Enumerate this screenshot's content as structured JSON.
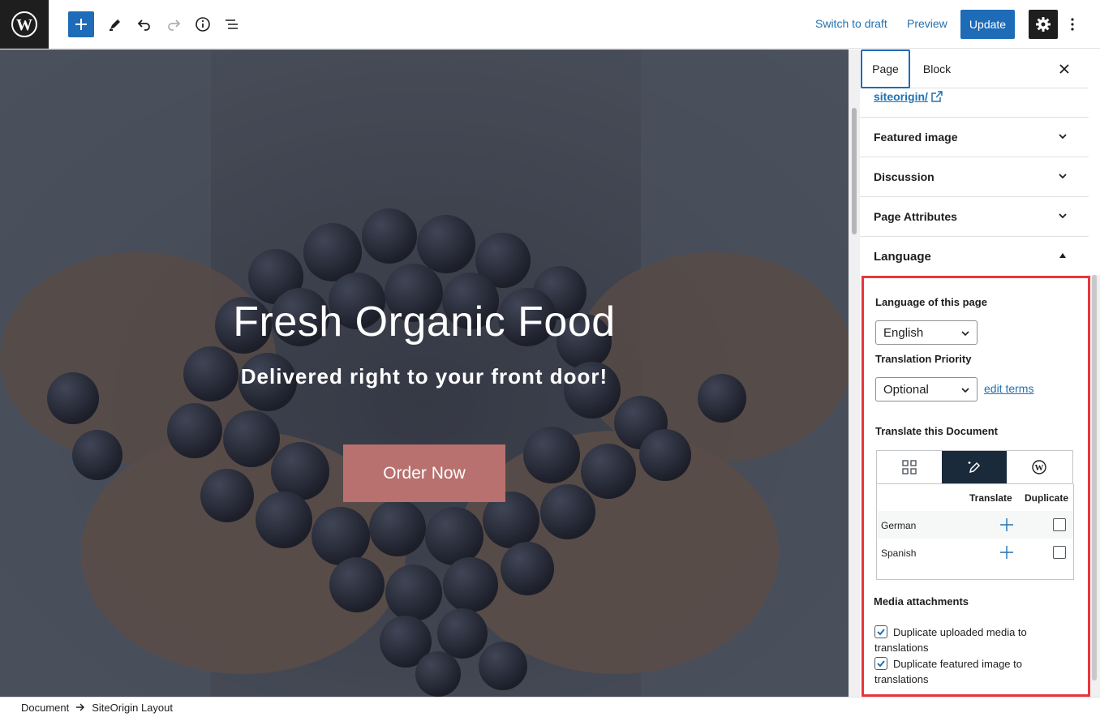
{
  "toolbar": {
    "logo_icon": "wordpress-logo-icon",
    "add_icon": "plus-icon",
    "edit_icon": "pencil-icon",
    "undo_icon": "undo-icon",
    "redo_icon": "redo-icon",
    "info_icon": "info-icon",
    "list_view_icon": "list-view-icon",
    "switch_to_draft": "Switch to draft",
    "preview": "Preview",
    "update": "Update",
    "settings_icon": "gear-icon",
    "options_icon": "vertical-ellipsis-icon"
  },
  "hero": {
    "title": "Fresh Organic Food",
    "subtitle": "Delivered right to your front door!",
    "button": "Order Now",
    "button_color": "#b8716e"
  },
  "sidebar": {
    "tabs": [
      {
        "label": "Page",
        "active": true
      },
      {
        "label": "Block",
        "active": false
      }
    ],
    "permalink": "siteorigin/",
    "panels": [
      {
        "label": "Featured image"
      },
      {
        "label": "Discussion"
      },
      {
        "label": "Page Attributes"
      },
      {
        "label": "Language"
      }
    ],
    "language": {
      "language_label": "Language of this page",
      "language_value": "English",
      "priority_label": "Translation Priority",
      "priority_value": "Optional",
      "edit_terms": "edit terms",
      "translate_label": "Translate this Document",
      "table": {
        "col_translate": "Translate",
        "col_duplicate": "Duplicate",
        "rows": [
          {
            "language": "German",
            "duplicate": false
          },
          {
            "language": "Spanish",
            "duplicate": false
          }
        ]
      },
      "media_label": "Media attachments",
      "media_options": [
        {
          "label": "Duplicate uploaded media to translations",
          "checked": true
        },
        {
          "label": "Duplicate featured image to translations",
          "checked": true
        }
      ]
    }
  },
  "breadcrumb": {
    "items": [
      "Document",
      "SiteOrigin Layout"
    ]
  },
  "colors": {
    "accent": "#1e6bb8",
    "highlight_border": "#e8363d"
  }
}
